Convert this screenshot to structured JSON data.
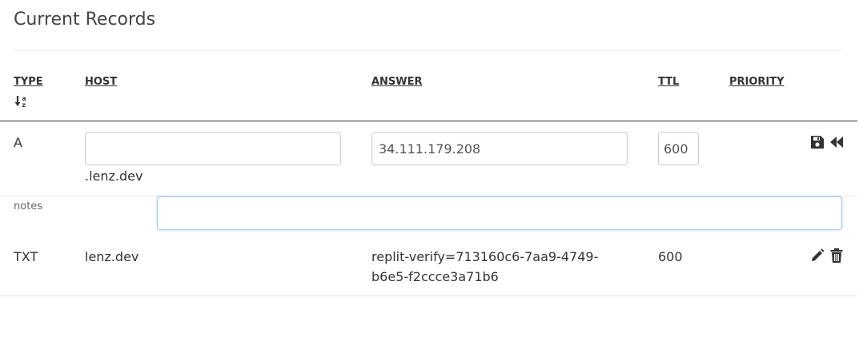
{
  "page": {
    "title": "Current Records"
  },
  "table": {
    "headers": {
      "type": "TYPE",
      "host": "HOST",
      "answer": "ANSWER",
      "ttl": "TTL",
      "priority": "PRIORITY"
    },
    "sort_icon": "sort-alpha-down-icon"
  },
  "edit_row": {
    "type": "A",
    "host_value": "",
    "host_suffix": ".lenz.dev",
    "answer_value": "34.111.179.208",
    "ttl_value": "600",
    "notes_label": "notes",
    "notes_value": "",
    "icons": [
      "save-icon",
      "revert-icon"
    ]
  },
  "records": [
    {
      "type": "TXT",
      "host": "lenz.dev",
      "answer_line1": "replit-verify=713160c6-7aa9-4749-",
      "answer_line2": "b6e5-f2ccce3a71b6",
      "ttl": "600",
      "icons": [
        "edit-icon",
        "trash-icon"
      ]
    }
  ],
  "colors": {
    "text": "#333333",
    "border": "#cccccc",
    "focus": "#a9c9ec"
  }
}
